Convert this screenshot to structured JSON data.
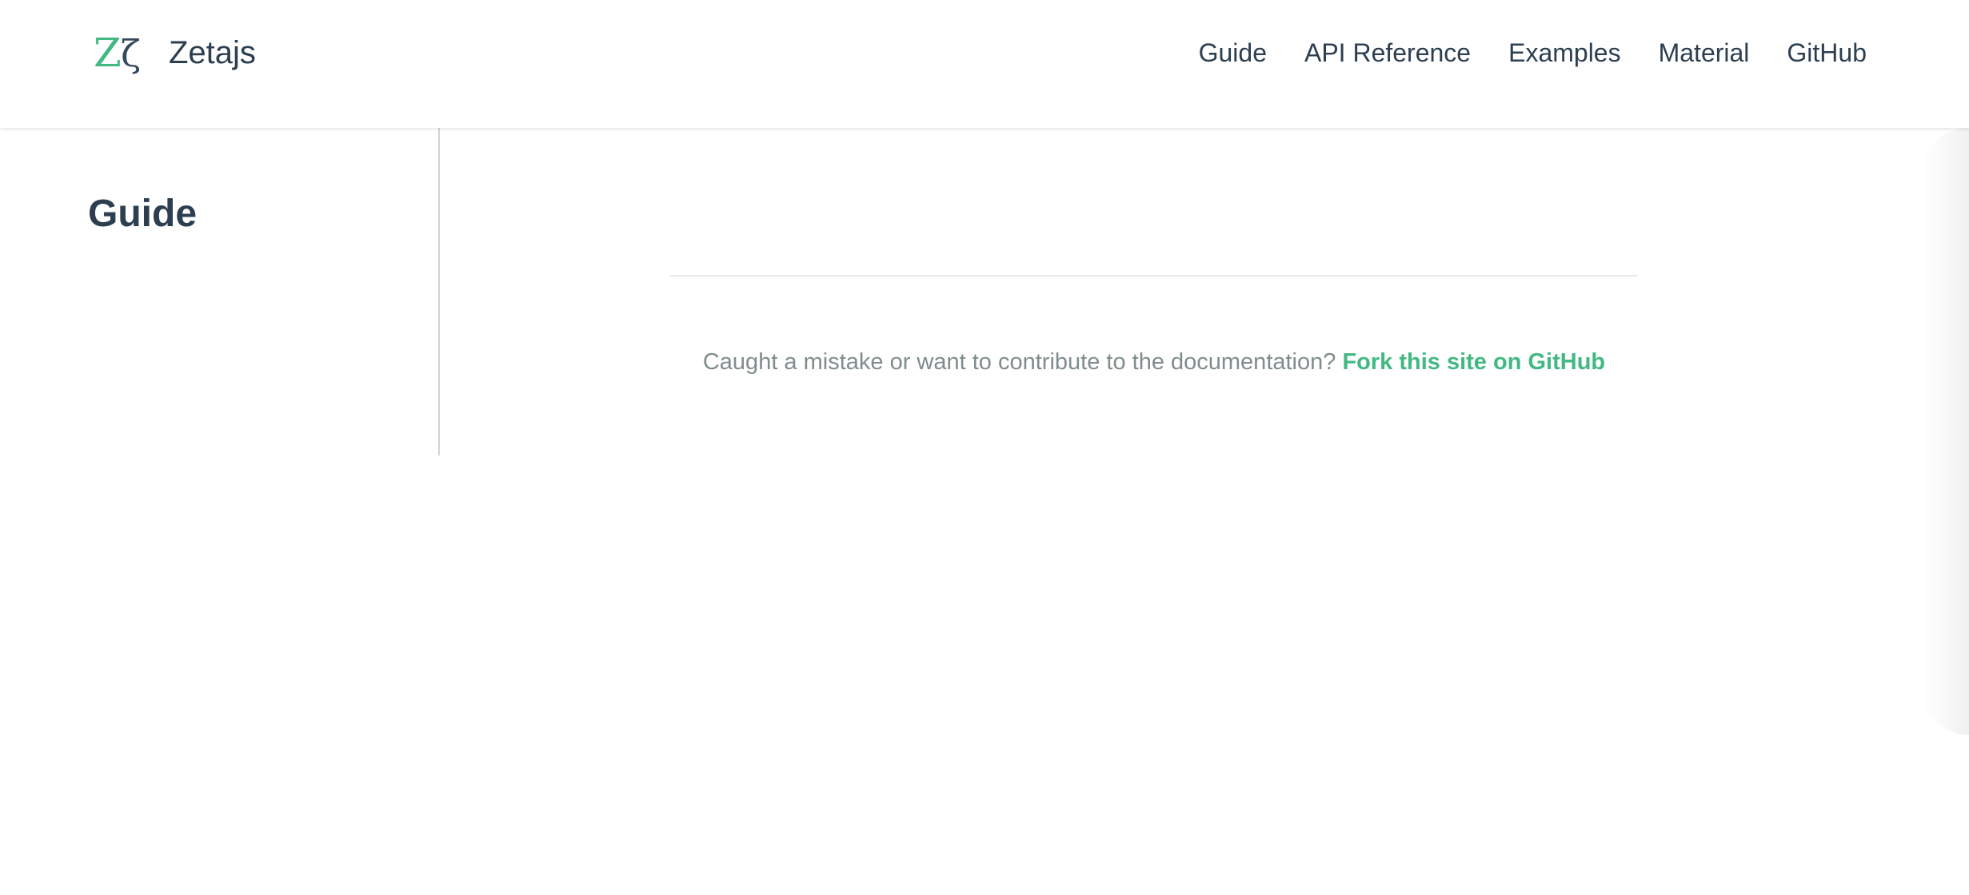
{
  "header": {
    "brand": {
      "logo_icon": "zeta-logo-icon",
      "logo_text": "Zζ",
      "title": "Zetajs"
    },
    "nav": [
      {
        "label": "Guide"
      },
      {
        "label": "API Reference"
      },
      {
        "label": "Examples"
      },
      {
        "label": "Material"
      },
      {
        "label": "GitHub"
      }
    ]
  },
  "sidebar": {
    "title": "Guide"
  },
  "main": {
    "footer_text": "Caught a mistake or want to contribute to the documentation?",
    "footer_link": "Fork this site on GitHub"
  },
  "colors": {
    "accent": "#42b983",
    "text": "#2c3e50",
    "muted": "#7f8c8d"
  }
}
